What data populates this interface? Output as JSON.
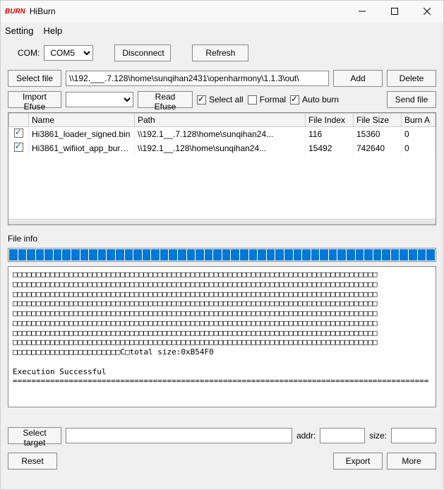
{
  "window": {
    "title": "HiBurn",
    "icon_text": "BURN"
  },
  "menu": {
    "setting": "Setting",
    "help": "Help"
  },
  "com": {
    "label": "COM:",
    "selected": "COM5",
    "disconnect": "Disconnect",
    "refresh": "Refresh"
  },
  "filerow": {
    "select_file": "Select file",
    "path": "\\\\192.___.7.128\\home\\sunqihan2431\\openharmony\\1.1.3\\out\\",
    "add": "Add",
    "delete": "Delete"
  },
  "efuserow": {
    "import_efuse": "Import Efuse",
    "read_efuse": "Read Efuse",
    "select_all": "Select all",
    "formal": "Formal",
    "auto_burn": "Auto burn",
    "send_file": "Send file",
    "dropdown_value": "",
    "select_all_checked": true,
    "formal_checked": false,
    "auto_burn_checked": true
  },
  "table": {
    "headers": {
      "blank": "",
      "name": "Name",
      "path": "Path",
      "file_index": "File Index",
      "file_size": "File Size",
      "burn_addr": "Burn A"
    },
    "rows": [
      {
        "checked": true,
        "name": "Hi3861_loader_signed.bin",
        "path": "\\\\192.1__.7.128\\home\\sunqihan24...",
        "file_index": "116",
        "file_size": "15360",
        "burn_addr": "0"
      },
      {
        "checked": true,
        "name": "Hi3861_wifiiot_app_burn...",
        "path": "\\\\192.1__.128\\home\\sunqihan24...",
        "file_index": "15492",
        "file_size": "742640",
        "burn_addr": "0"
      }
    ]
  },
  "fileinfo": {
    "label": "File info",
    "blocks_line": "CCCCCCCCCCCCCCCCCCCCCCCCCCCCCCCCCCCCCCCCCCCCCCCCCCCCCCCCCCCCCCCCCCCCCCCCCCCCCCCCCCCCCCCCCC",
    "blocks_last": "CCCCCCCCCCCCCCCCCCCCCCCCC",
    "total_size": "total size:0xB54F0",
    "exec_ok": "Execution Successful",
    "separator": "========================================================================================="
  },
  "bottom": {
    "select_target": "Select target",
    "addr_label": "addr:",
    "size_label": "size:",
    "target_value": "",
    "addr_value": "",
    "size_value": ""
  },
  "footer": {
    "reset": "Reset",
    "export": "Export",
    "more": "More"
  }
}
